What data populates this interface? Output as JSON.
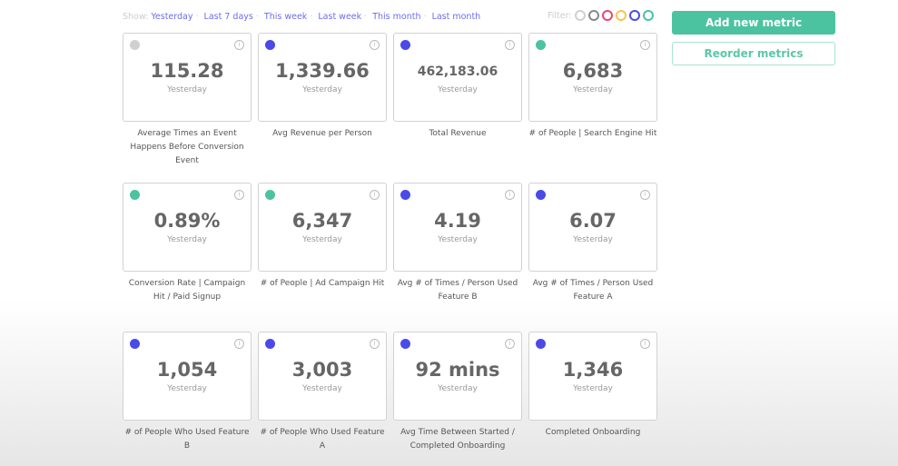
{
  "show": {
    "label": "Show:",
    "options": [
      "Yesterday",
      "Last 7 days",
      "This week",
      "Last week",
      "This month",
      "Last month"
    ]
  },
  "filter": {
    "label": "Filter:",
    "colors": [
      "#d0d0d0",
      "#888888",
      "#e8487a",
      "#f0c94a",
      "#4a4ae8",
      "#4cc3a0"
    ]
  },
  "buttons": {
    "add": "Add new metric",
    "reorder": "Reorder metrics"
  },
  "metrics": [
    {
      "value": "115.28",
      "period": "Yesterday",
      "label": "Average Times an Event Happens Before Conversion Event",
      "color": "#d0d0d0"
    },
    {
      "value": "1,339.66",
      "period": "Yesterday",
      "label": "Avg Revenue per Person",
      "color": "#4a4ae8"
    },
    {
      "value": "462,183.06",
      "period": "Yesterday",
      "label": "Total Revenue",
      "color": "#4a4ae8"
    },
    {
      "value": "6,683",
      "period": "Yesterday",
      "label": "# of People | Search Engine Hit",
      "color": "#4cc3a0"
    },
    {
      "value": "0.89%",
      "period": "Yesterday",
      "label": "Conversion Rate | Campaign Hit / Paid Signup",
      "color": "#4cc3a0"
    },
    {
      "value": "6,347",
      "period": "Yesterday",
      "label": "# of People | Ad Campaign Hit",
      "color": "#4cc3a0"
    },
    {
      "value": "4.19",
      "period": "Yesterday",
      "label": "Avg # of Times / Person Used Feature B",
      "color": "#4a4ae8"
    },
    {
      "value": "6.07",
      "period": "Yesterday",
      "label": "Avg # of Times / Person Used Feature A",
      "color": "#4a4ae8"
    },
    {
      "value": "1,054",
      "period": "Yesterday",
      "label": "# of People Who Used Feature B",
      "color": "#4a4ae8"
    },
    {
      "value": "3,003",
      "period": "Yesterday",
      "label": "# of People Who Used Feature A",
      "color": "#4a4ae8"
    },
    {
      "value": "92 mins",
      "period": "Yesterday",
      "label": "Avg Time Between Started / Completed Onboarding",
      "color": "#4a4ae8"
    },
    {
      "value": "1,346",
      "period": "Yesterday",
      "label": "Completed Onboarding",
      "color": "#4a4ae8"
    }
  ]
}
